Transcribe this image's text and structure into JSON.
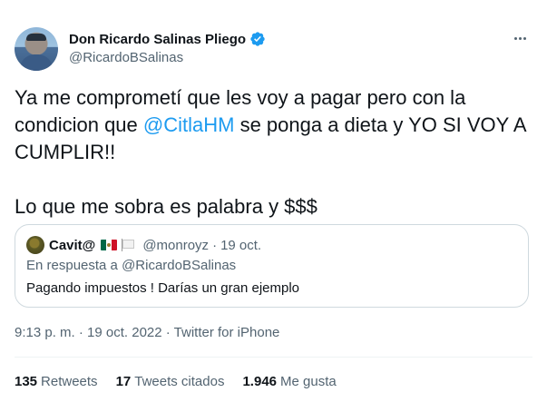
{
  "author": {
    "display_name": "Don Ricardo Salinas Pliego",
    "handle": "@RicardoBSalinas",
    "verified": true,
    "verified_color": "#1d9bf0"
  },
  "tweet": {
    "line1_pre": "Ya me comprometí que les voy a pagar pero con la condicion que ",
    "mention": "@CitlaHM",
    "line1_post": " se ponga a dieta y YO SI VOY A CUMPLIR!!",
    "line2": "Lo que me sobra es palabra y $$$"
  },
  "quoted_tweet": {
    "display_name": "Cavit@",
    "handle": "@monroyz",
    "separator": "·",
    "date": "19 oct.",
    "reply_to": "En respuesta a @RicardoBSalinas",
    "text": "Pagando impuestos ! Darías un gran ejemplo",
    "flags": [
      "mexico-flag-icon",
      "white-flag-icon"
    ]
  },
  "meta": {
    "text": "9:13 p. m. · 19 oct. 2022 · Twitter for iPhone"
  },
  "stats": {
    "retweets_count": "135",
    "retweets_label": "Retweets",
    "quotes_count": "17",
    "quotes_label": "Tweets citados",
    "likes_count": "1.946",
    "likes_label": "Me gusta"
  },
  "colors": {
    "link": "#1d9bf0",
    "secondary_text": "#536471",
    "primary_text": "#0f1419",
    "border": "#cfd9de"
  }
}
